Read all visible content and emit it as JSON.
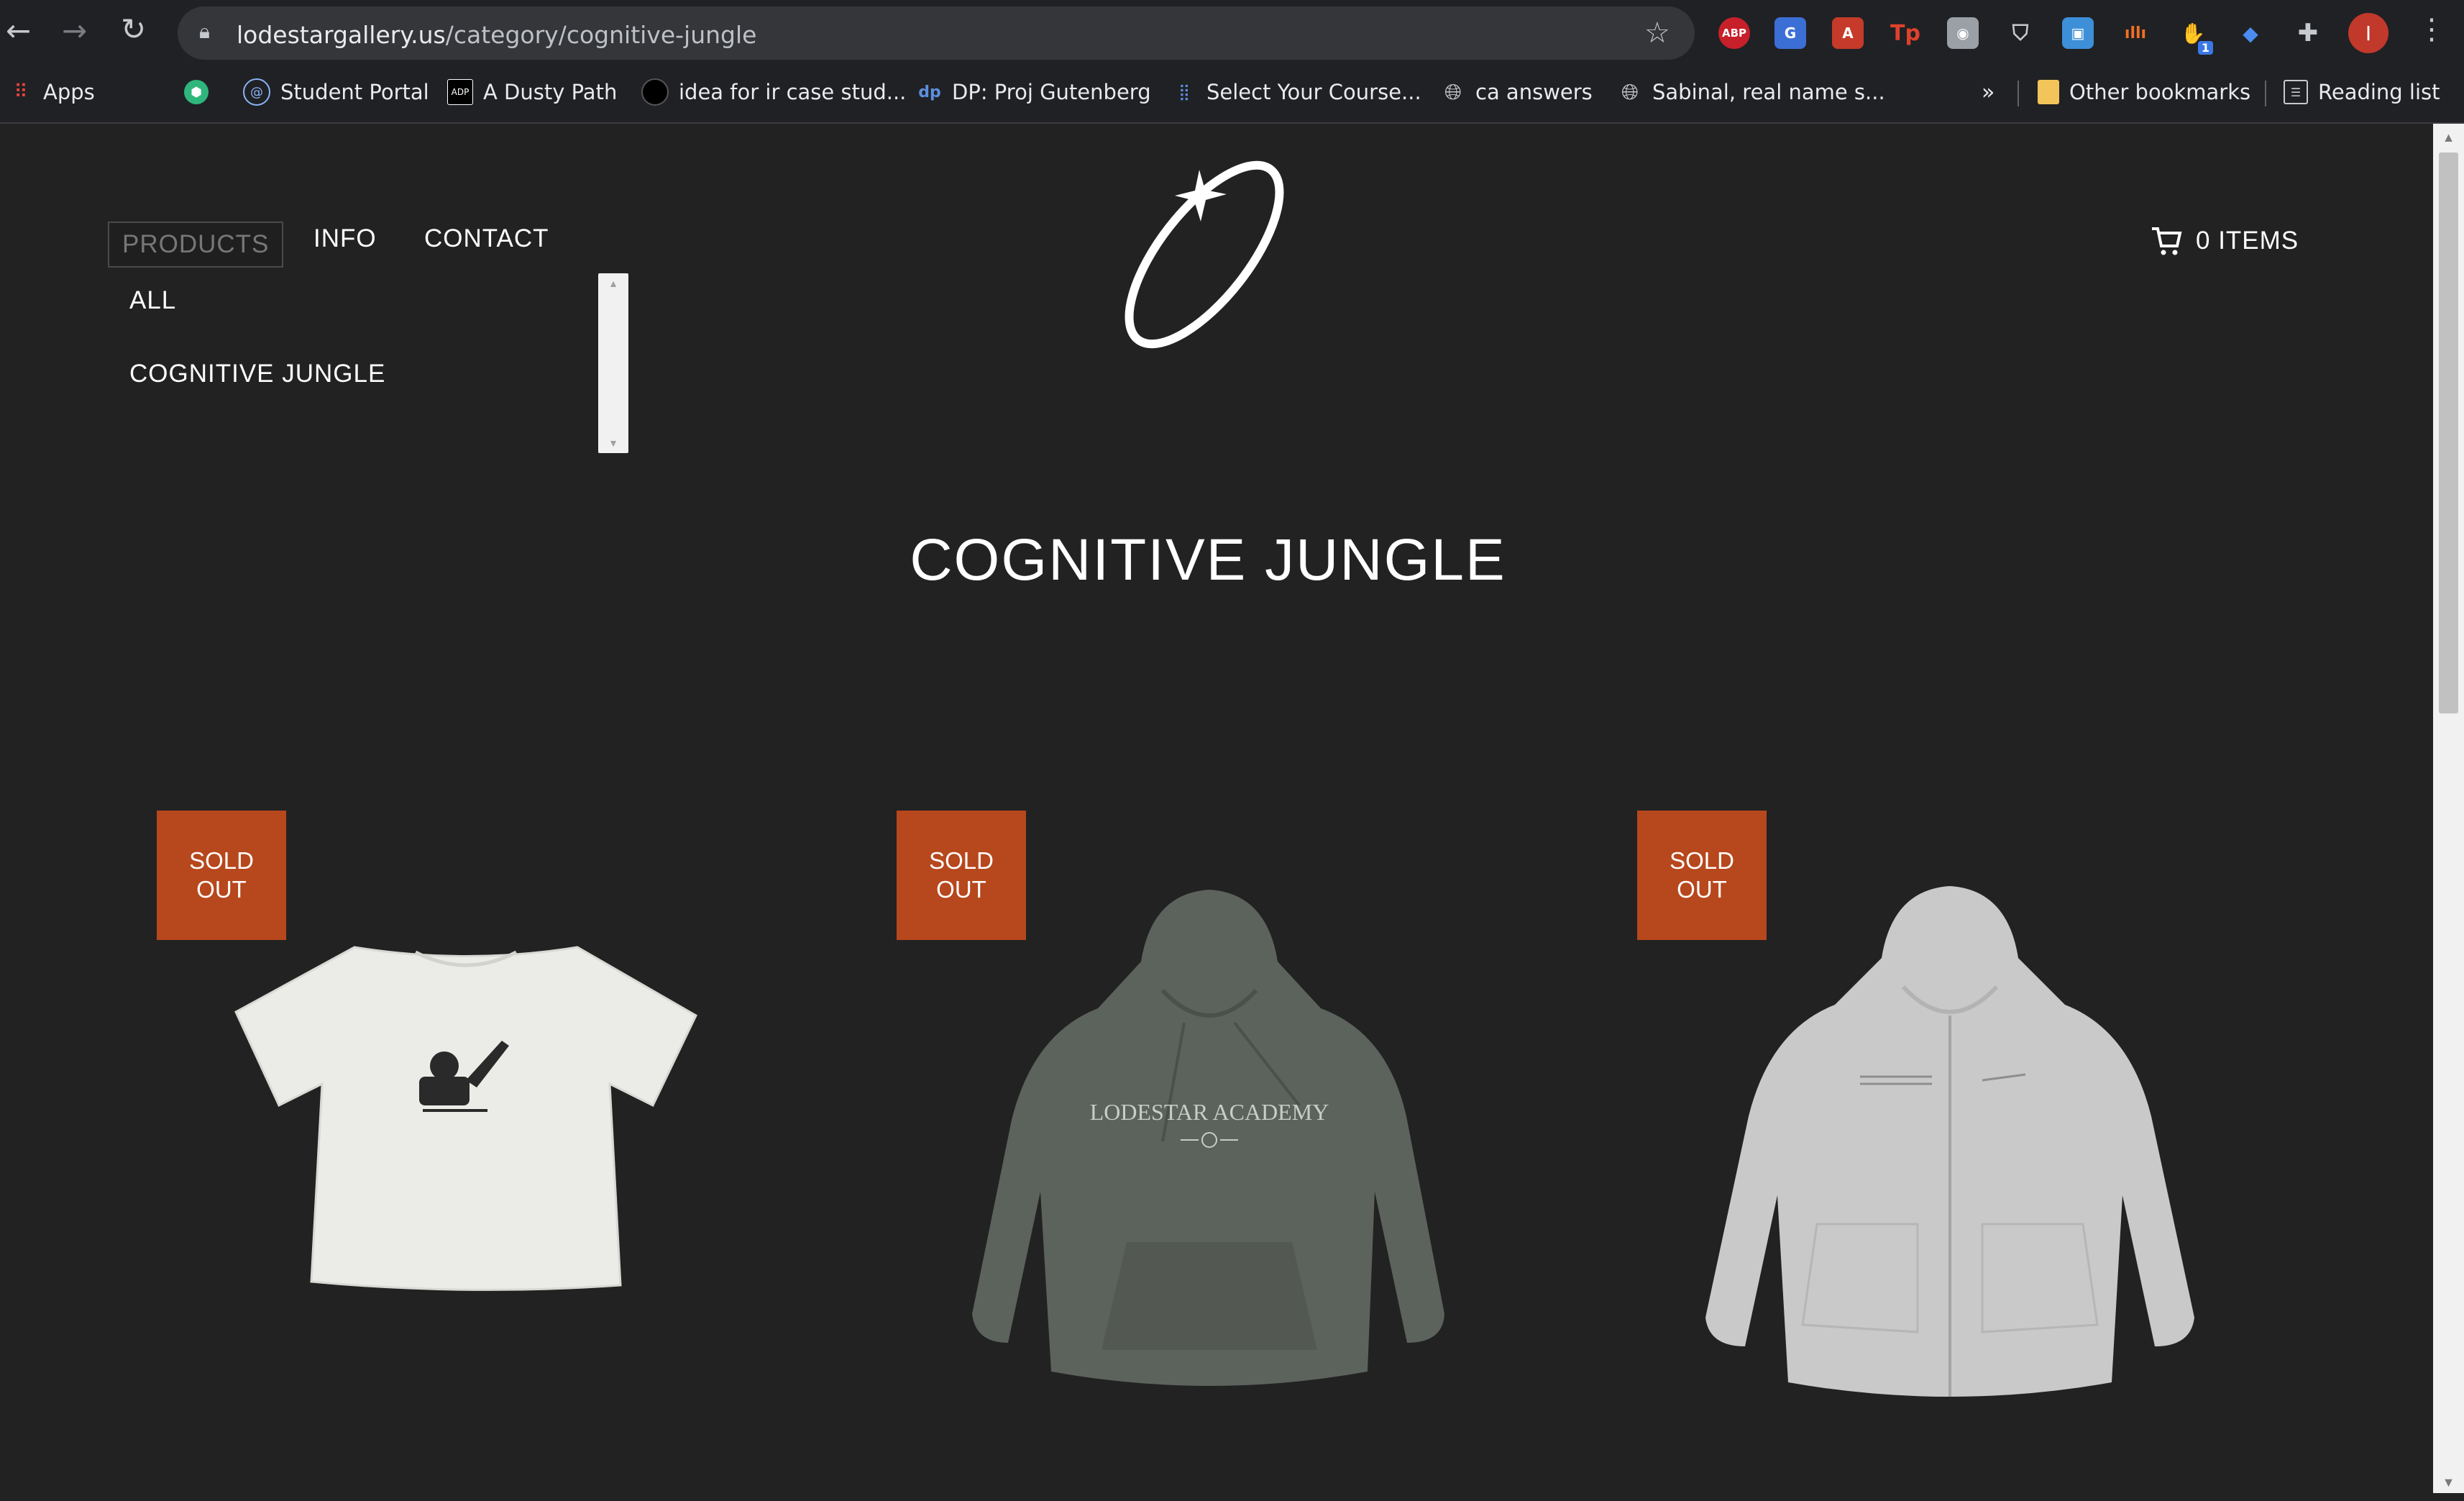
{
  "browser": {
    "url_host": "lodestargallery.us",
    "url_path": "/category/cognitive-jungle",
    "profile_initial": "I",
    "extensions": [
      "ABP",
      "G",
      "A",
      "Tp",
      "◉",
      "pocket",
      "▣",
      "ıllı",
      "✋",
      "◆"
    ],
    "extension_badge": "1",
    "bookmarks": [
      {
        "label": "Apps",
        "icon": "apps-grid-icon"
      },
      {
        "label": "",
        "icon": "shield-icon"
      },
      {
        "label": "Student Portal",
        "icon": "spiral-icon"
      },
      {
        "label": "A Dusty Path",
        "icon": "adp-icon"
      },
      {
        "label": "idea for ir case stud...",
        "icon": "dark-globe-icon"
      },
      {
        "label": "DP: Proj Gutenberg",
        "icon": "dp-icon"
      },
      {
        "label": "Select Your Course...",
        "icon": "dots-icon"
      },
      {
        "label": "ca answers",
        "icon": "globe-icon"
      },
      {
        "label": "Sabinal, real name s...",
        "icon": "globe-icon"
      }
    ],
    "bookmarks_overflow": "»",
    "other_bookmarks": "Other bookmarks",
    "reading_list": "Reading list"
  },
  "nav": {
    "products": "PRODUCTS",
    "info": "INFO",
    "contact": "CONTACT",
    "dropdown": [
      "ALL",
      "COGNITIVE JUNGLE"
    ]
  },
  "cart": {
    "label": "0 ITEMS"
  },
  "page": {
    "title": "COGNITIVE JUNGLE"
  },
  "products": [
    {
      "badge_line1": "SOLD",
      "badge_line2": "OUT",
      "image": "white-tshirt",
      "price": ""
    },
    {
      "badge_line1": "SOLD",
      "badge_line2": "OUT",
      "image": "grey-green-hoodie",
      "hoodie_text": "LODESTAR ACADEMY",
      "price": ""
    },
    {
      "badge_line1": "SOLD",
      "badge_line2": "OUT",
      "image": "heather-grey-zip-hoodie",
      "price": ""
    }
  ],
  "colors": {
    "background": "#222222",
    "badge": "#b7471c",
    "text": "#ffffff",
    "chrome": "#202124"
  }
}
